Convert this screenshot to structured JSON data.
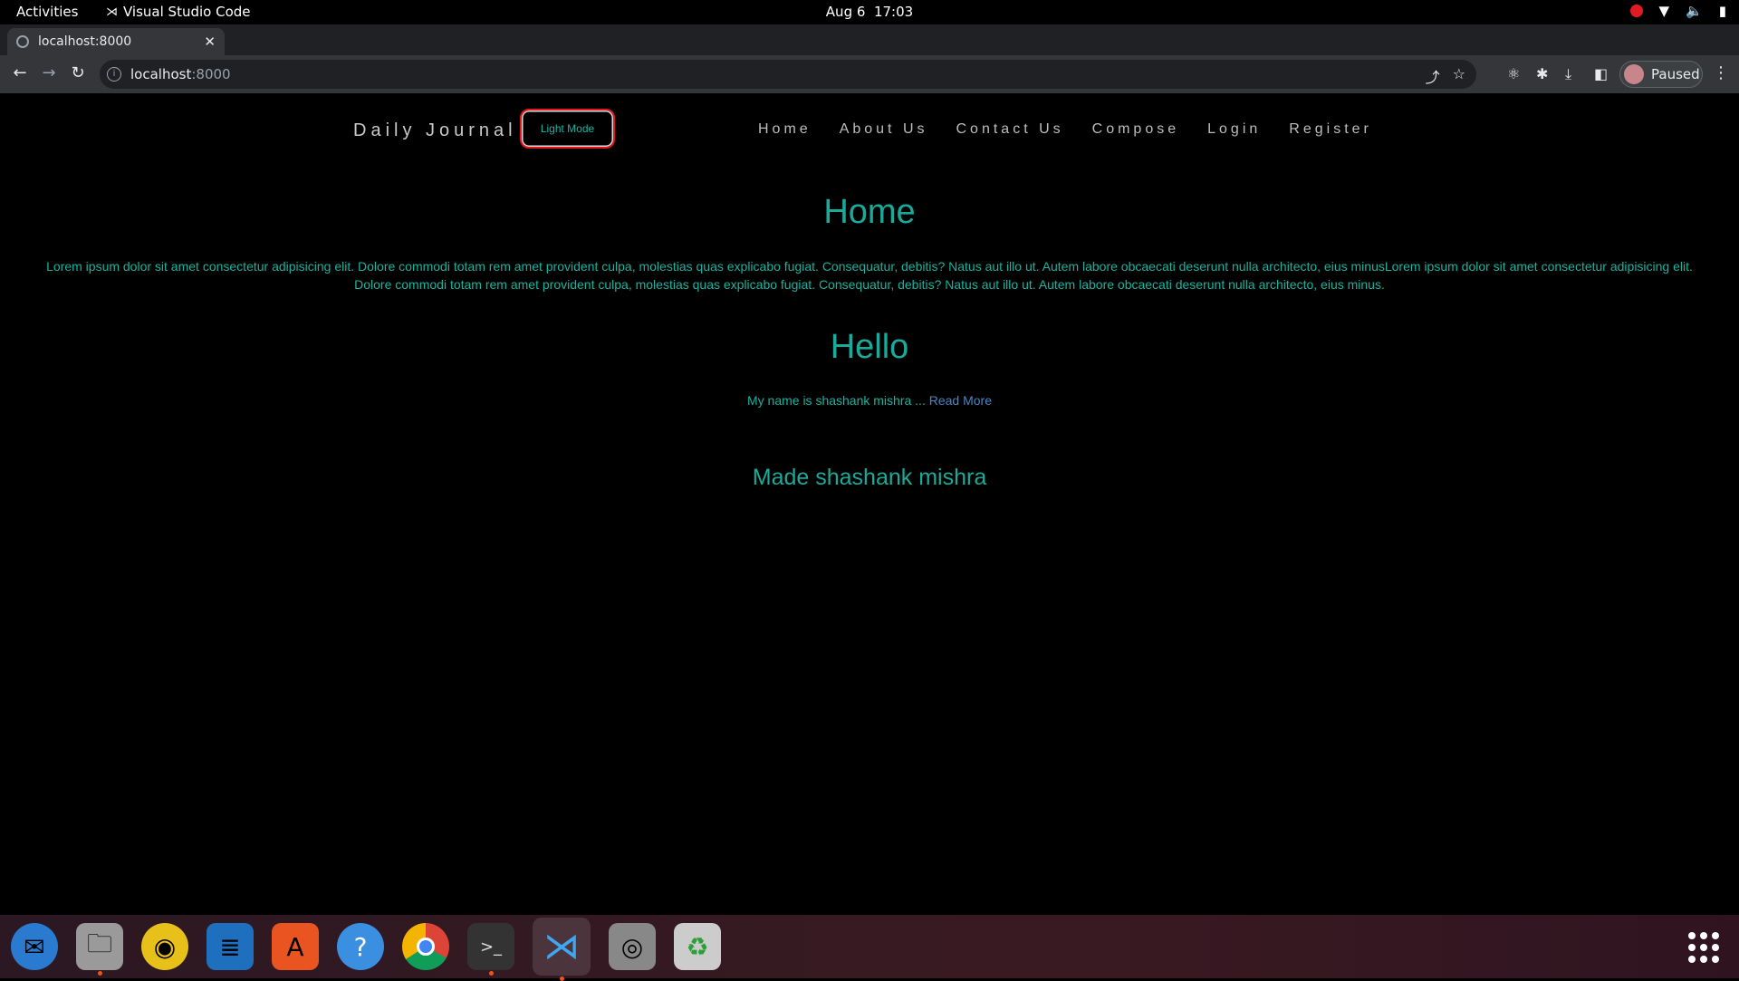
{
  "system": {
    "activities": "Activities",
    "app_name": "Visual Studio Code",
    "date": "Aug 6",
    "time": "17:03"
  },
  "browser": {
    "tab_title": "localhost:8000",
    "url_host": "localhost",
    "url_port": ":8000",
    "profile_status": "Paused"
  },
  "site": {
    "brand": "Daily Journal",
    "mode_button": "Light Mode",
    "nav": [
      "Home",
      "About Us",
      "Contact Us",
      "Compose",
      "Login",
      "Register"
    ],
    "home_title": "Home",
    "home_text": "Lorem ipsum dolor sit amet consectetur adipisicing elit. Dolore commodi totam rem amet provident culpa, molestias quas explicabo fugiat. Consequatur, debitis? Natus aut illo ut. Autem labore obcaecati deserunt nulla architecto, eius minusLorem ipsum dolor sit amet consectetur adipisicing elit. Dolore commodi totam rem amet provident culpa, molestias quas explicabo fugiat. Consequatur, debitis? Natus aut illo ut. Autem labore obcaecati deserunt nulla architecto, eius minus.",
    "post_title": "Hello",
    "post_excerpt": "My name is shashank mishra ...",
    "read_more": "Read More",
    "footer": "Made shashank mishra"
  },
  "colors": {
    "accent": "#1aaa9a",
    "link": "#4a86c5",
    "button_border": "#e2161b"
  }
}
